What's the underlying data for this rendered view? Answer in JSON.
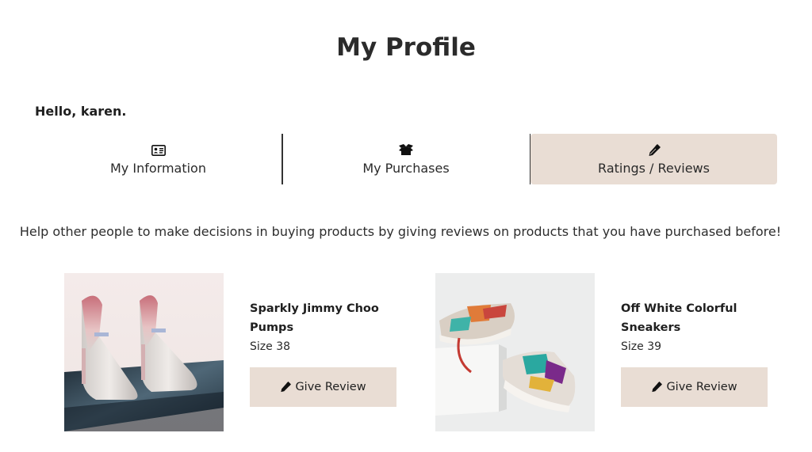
{
  "header": {
    "title": "My Profile"
  },
  "greeting": "Hello, karen.",
  "tabs": [
    {
      "label": "My Information",
      "icon": "id-card-icon",
      "active": false
    },
    {
      "label": "My Purchases",
      "icon": "box-open-icon",
      "active": false
    },
    {
      "label": "Ratings / Reviews",
      "icon": "pen-icon",
      "active": true
    }
  ],
  "help_text": "Help other people to make decisions in buying products by giving reviews on products that you have purchased before!",
  "products": [
    {
      "name_line1": "Sparkly Jimmy Choo",
      "name_line2": "Pumps",
      "size": "Size 38",
      "button_label": "Give Review",
      "image": "glitter-pumps-photo"
    },
    {
      "name_line1": "Off White Colorful",
      "name_line2": "Sneakers",
      "size": "Size 39",
      "button_label": "Give Review",
      "image": "sneakers-photo"
    }
  ],
  "colors": {
    "accent_bg": "#e9ddd4",
    "text": "#222222"
  }
}
